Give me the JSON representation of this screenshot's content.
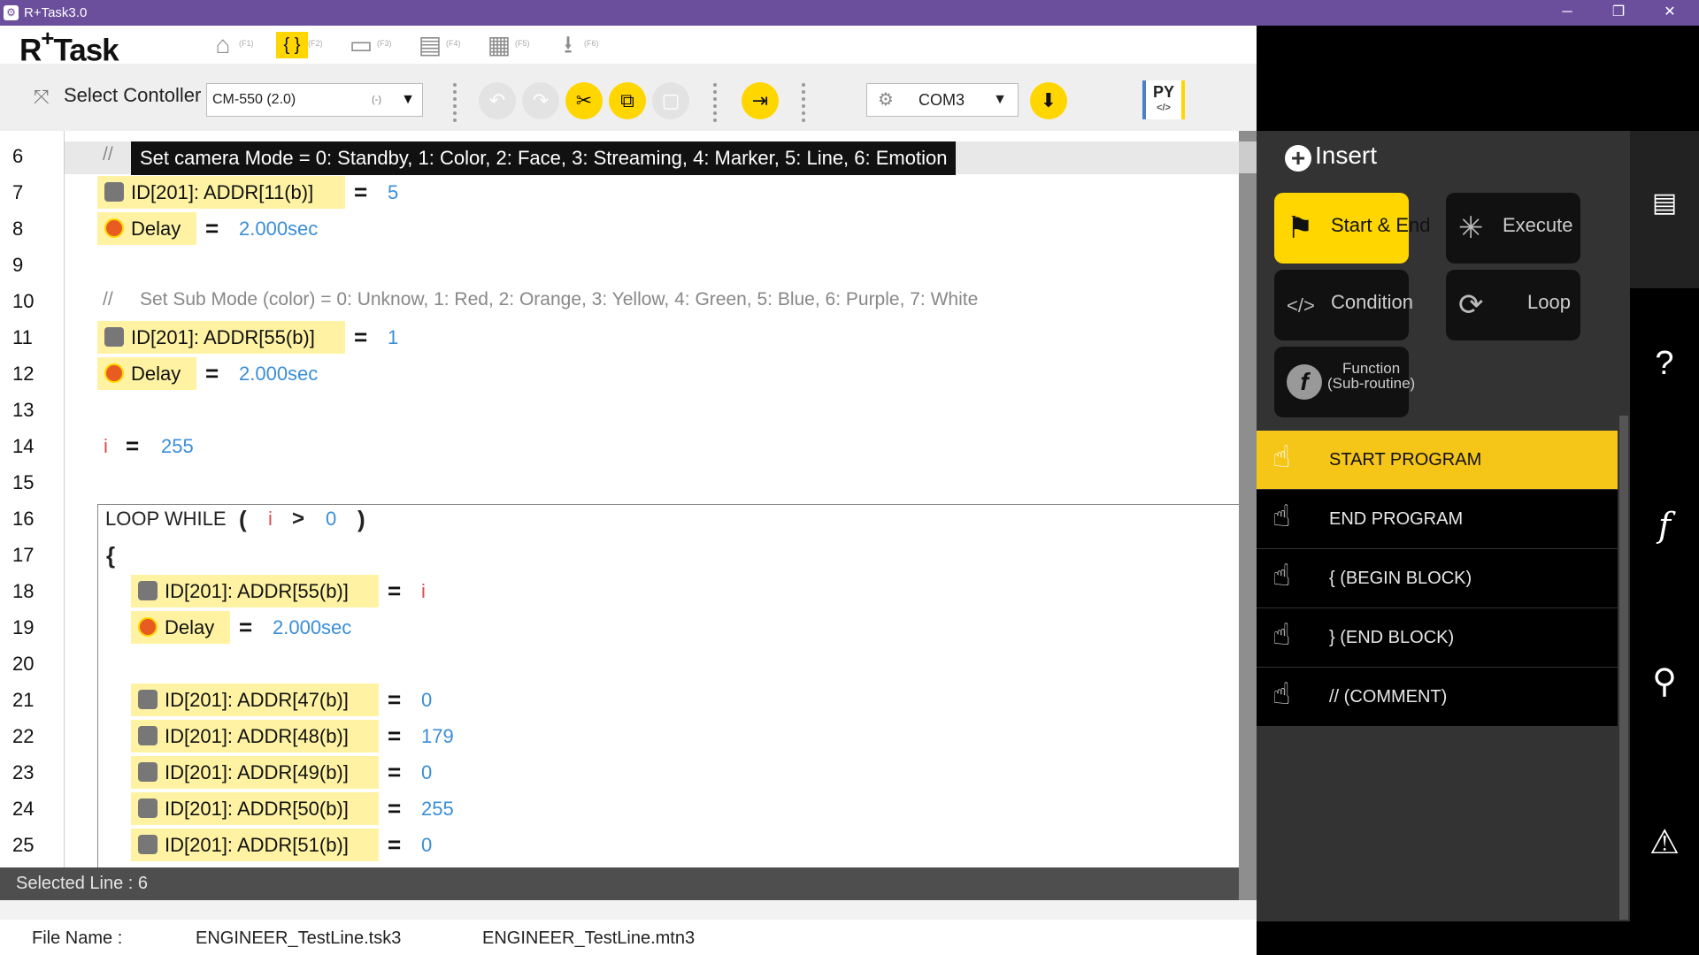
{
  "window": {
    "title": "R+Task3.0",
    "minimize": "─",
    "restore": "❐",
    "close": "✕"
  },
  "logo": {
    "text": "R",
    "plus": "+",
    "rest": "Task"
  },
  "modes": [
    {
      "key": "(F1)",
      "icon": "home-icon"
    },
    {
      "key": "(F2)",
      "icon": "code-icon"
    },
    {
      "key": "(F3)",
      "icon": "monitor-icon"
    },
    {
      "key": "(F4)",
      "icon": "film-icon"
    },
    {
      "key": "(F5)",
      "icon": "clapper-icon"
    },
    {
      "key": "(F6)",
      "icon": "download-icon"
    }
  ],
  "toolbar": {
    "select_controller_label": "Select Contoller",
    "controller_value": "CM-550 (2.0)",
    "controller_sub": "(-)",
    "port_value": "COM3",
    "py_label": "PY",
    "py_sub": "</>"
  },
  "editor": {
    "line_numbers": [
      "6",
      "7",
      "8",
      "9",
      "10",
      "11",
      "12",
      "13",
      "14",
      "15",
      "16",
      "17",
      "18",
      "19",
      "20",
      "21",
      "22",
      "23",
      "24",
      "25"
    ],
    "comment_slash": "//",
    "line6_comment": "Set camera Mode = 0: Standby, 1: Color, 2: Face, 3: Streaming, 4: Marker, 5: Line, 6: Emotion",
    "line10_comment": "Set Sub Mode (color) = 0: Unknow, 1: Red, 2: Orange, 3: Yellow, 4: Green, 5: Blue, 6: Purple, 7: White",
    "l7_block": "ID[201]: ADDR[11(b)]",
    "l7_val": "5",
    "delay_label": "Delay",
    "delay_val": "2.000sec",
    "l11_block": "ID[201]: ADDR[55(b)]",
    "l11_val": "1",
    "var_i": "i",
    "l14_val": "255",
    "loop_kw": "LOOP WHILE",
    "lparen": "(",
    "rparen": ")",
    "gt": ">",
    "loop_val": "0",
    "lbrace": "{",
    "l18_block": "ID[201]: ADDR[55(b)]",
    "l21_block": "ID[201]: ADDR[47(b)]",
    "l21_val": "0",
    "l22_block": "ID[201]: ADDR[48(b)]",
    "l22_val": "179",
    "l23_block": "ID[201]: ADDR[49(b)]",
    "l23_val": "0",
    "l24_block": "ID[201]: ADDR[50(b)]",
    "l24_val": "255",
    "l25_block": "ID[201]: ADDR[51(b)]",
    "l25_val": "0",
    "eq": "="
  },
  "status": {
    "selected_line": "Selected Line : 6"
  },
  "file": {
    "label": "File Name :",
    "task": "ENGINEER_TestLine.tsk3",
    "motion": "ENGINEER_TestLine.mtn3"
  },
  "insert": {
    "title": "Insert",
    "categories": [
      {
        "label": "Start & End",
        "icon": "flag-icon",
        "active": true
      },
      {
        "label": "Execute",
        "icon": "spinner-icon"
      },
      {
        "label": "Condition",
        "icon": "code-window-icon"
      },
      {
        "label": "Loop",
        "icon": "refresh-icon"
      },
      {
        "label": "Function\n(Sub-routine)",
        "icon": "function-icon"
      }
    ],
    "items": [
      {
        "label": "START PROGRAM",
        "active": true
      },
      {
        "label": "END PROGRAM"
      },
      {
        "label": "{  (BEGIN BLOCK)"
      },
      {
        "label": "}  (END BLOCK)"
      },
      {
        "label": "//  (COMMENT)"
      }
    ]
  },
  "sidebar": {
    "icons": [
      "chat-icon",
      "help-icon",
      "function-icon",
      "search-icon",
      "warning-icon"
    ]
  }
}
